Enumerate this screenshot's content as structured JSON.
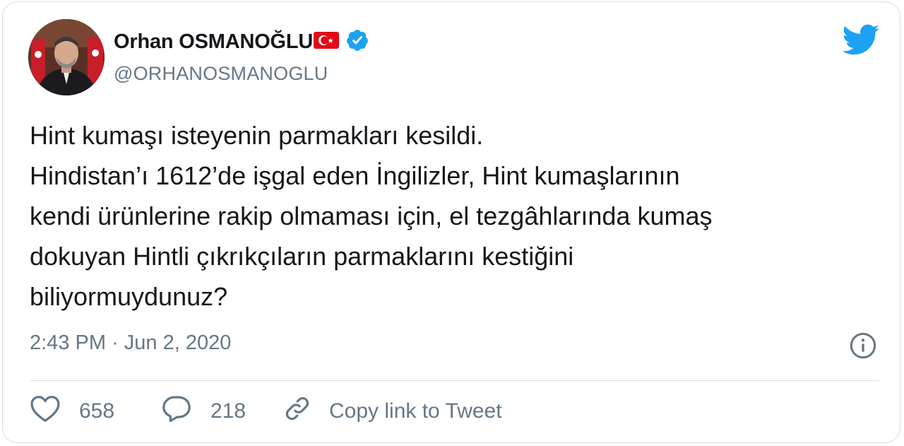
{
  "user": {
    "display_name": "Orhan OSMANOĞLU",
    "handle": "@ORHANOSMANOGLU",
    "flag": "turkey-flag",
    "verified_icon": "verified-badge-icon",
    "avatar": "profile-photo"
  },
  "brand": {
    "logo": "twitter-bird-icon",
    "accent": "#1da1f2"
  },
  "tweet": {
    "lines": [
      "Hint kumaşı isteyenin parmakları kesildi.",
      "Hindistan’ı 1612’de işgal eden İngilizler, Hint kumaşlarının",
      "kendi ürünlerine rakip olmaması için, el tezgâhlarında kumaş",
      "dokuyan Hintli çıkrıkçıların parmaklarını kestiğini",
      "biliyormuydunuz?"
    ],
    "time": "2:43 PM",
    "separator": "·",
    "date": "Jun 2, 2020"
  },
  "actions": {
    "likes": "658",
    "replies": "218",
    "copy_link_label": "Copy link to Tweet"
  }
}
